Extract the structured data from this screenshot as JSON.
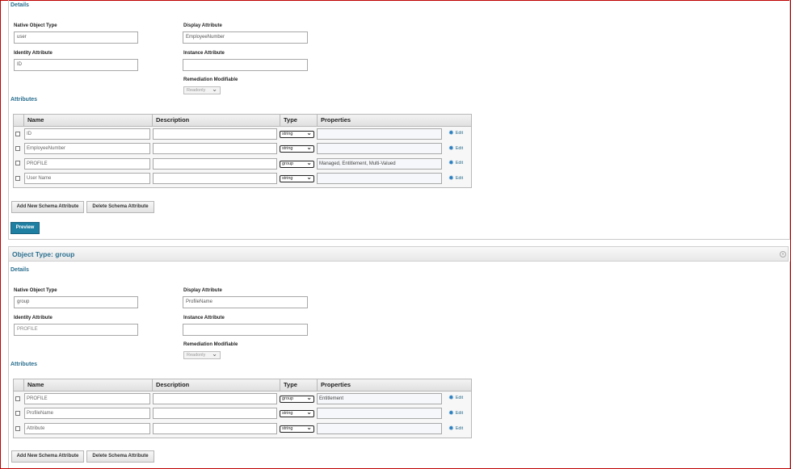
{
  "panel1": {
    "details_heading": "Details",
    "native_object_type": {
      "label": "Native Object Type",
      "value": "user"
    },
    "display_attribute": {
      "label": "Display Attribute",
      "value": "EmployeeNumber"
    },
    "identity_attribute": {
      "label": "Identity Attribute",
      "value": "ID"
    },
    "instance_attribute": {
      "label": "Instance Attribute",
      "value": ""
    },
    "remediation_modifiable": {
      "label": "Remediation Modifiable",
      "value": "Readonly"
    },
    "attributes_heading": "Attributes",
    "columns": [
      "Name",
      "Description",
      "Type",
      "Properties"
    ],
    "rows": [
      {
        "name": "ID",
        "description": "",
        "type": "string",
        "properties": "",
        "edit": "Edit"
      },
      {
        "name": "EmployeeNumber",
        "description": "",
        "type": "string",
        "properties": "",
        "edit": "Edit"
      },
      {
        "name": "PROFILE",
        "description": "",
        "type": "group",
        "properties": "Managed, Entitlement, Multi-Valued",
        "edit": "Edit"
      },
      {
        "name": "User Name",
        "description": "",
        "type": "string",
        "properties": "",
        "edit": "Edit"
      }
    ],
    "add_button": "Add New Schema Attribute",
    "delete_button": "Delete Schema Attribute",
    "preview_button": "Preview"
  },
  "panel2": {
    "object_type_title": "Object Type: group",
    "details_heading": "Details",
    "native_object_type": {
      "label": "Native Object Type",
      "value": "group"
    },
    "display_attribute": {
      "label": "Display Attribute",
      "value": "ProfileName"
    },
    "identity_attribute": {
      "label": "Identity Attribute",
      "value": "PROFILE"
    },
    "instance_attribute": {
      "label": "Instance Attribute",
      "value": ""
    },
    "remediation_modifiable": {
      "label": "Remediation Modifiable",
      "value": "Readonly"
    },
    "attributes_heading": "Attributes",
    "columns": [
      "Name",
      "Description",
      "Type",
      "Properties"
    ],
    "rows": [
      {
        "name": "PROFILE",
        "description": "",
        "type": "group",
        "properties": "Entitlement",
        "edit": "Edit"
      },
      {
        "name": "ProfileName",
        "description": "",
        "type": "string",
        "properties": "",
        "edit": "Edit"
      },
      {
        "name": "Attribute",
        "description": "",
        "type": "string",
        "properties": "",
        "edit": "Edit"
      }
    ],
    "add_button": "Add New Schema Attribute",
    "delete_button": "Delete Schema Attribute"
  },
  "colors": {
    "accent": "#2a6f8f",
    "primary_button": "#1f7fa3",
    "frame_border": "#c00000"
  },
  "icons": {
    "edit": "gear-icon",
    "dropdown": "chevron-down-icon",
    "collapse": "collapse-icon"
  }
}
